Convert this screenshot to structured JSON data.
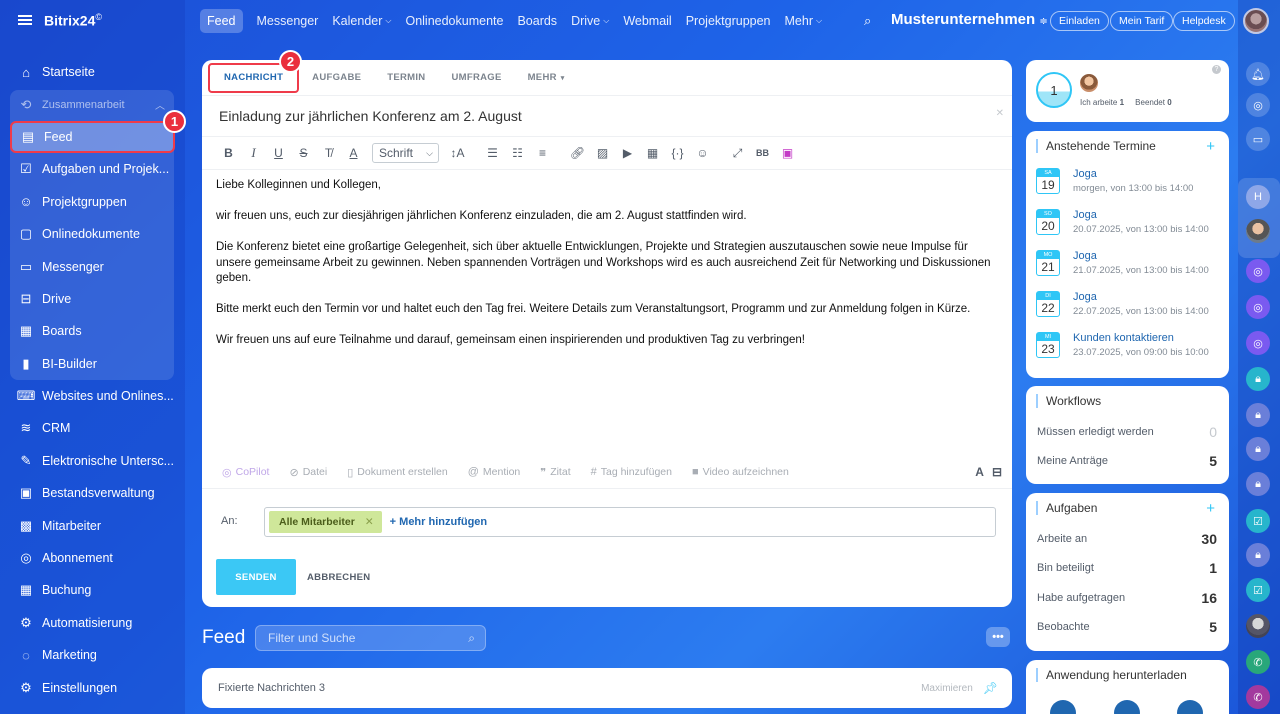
{
  "app": {
    "logo": "Bitrix24",
    "logo_mark": "©"
  },
  "sidebar": {
    "items": [
      {
        "label": "Startseite",
        "icon": "⌂"
      },
      {
        "label": "Zusammenarbeit",
        "icon": "⟲"
      },
      {
        "label": "Feed",
        "icon": "▤"
      },
      {
        "label": "Aufgaben und Projek...",
        "icon": "☑"
      },
      {
        "label": "Projektgruppen",
        "icon": "☺"
      },
      {
        "label": "Onlinedokumente",
        "icon": "▢"
      },
      {
        "label": "Messenger",
        "icon": "▭"
      },
      {
        "label": "Drive",
        "icon": "⊟"
      },
      {
        "label": "Boards",
        "icon": "▦"
      },
      {
        "label": "BI-Builder",
        "icon": "▮"
      },
      {
        "label": "Websites und Onlines...",
        "icon": "⌨"
      },
      {
        "label": "CRM",
        "icon": "≋"
      },
      {
        "label": "Elektronische Untersc...",
        "icon": "✎"
      },
      {
        "label": "Bestandsverwaltung",
        "icon": "▣"
      },
      {
        "label": "Mitarbeiter",
        "icon": "▩"
      },
      {
        "label": "Abonnement",
        "icon": "◎"
      },
      {
        "label": "Buchung",
        "icon": "▦"
      },
      {
        "label": "Automatisierung",
        "icon": "⚙"
      },
      {
        "label": "Marketing",
        "icon": "◌"
      },
      {
        "label": "Einstellungen",
        "icon": "⚙"
      }
    ],
    "badge": "1"
  },
  "topbar": {
    "items": [
      "Feed",
      "Messenger",
      "Kalender",
      "Onlinedokumente",
      "Boards",
      "Drive",
      "Webmail",
      "Projektgruppen",
      "Mehr"
    ],
    "company": "Musterunternehmen",
    "invite": "Einladen",
    "tariff": "Mein Tarif",
    "helpdesk": "Helpdesk"
  },
  "composer": {
    "tabs": [
      "NACHRICHT",
      "AUFGABE",
      "TERMIN",
      "UMFRAGE",
      "MEHR"
    ],
    "badge": "2",
    "title": "Einladung zur jährlichen Konferenz am 2. August",
    "font": "Schrift",
    "body": [
      "Liebe Kolleginnen und Kollegen,",
      "wir freuen uns, euch zur diesjährigen jährlichen Konferenz einzuladen, die am 2. August stattfinden wird.",
      "Die Konferenz bietet eine großartige Gelegenheit, sich über aktuelle Entwicklungen, Projekte und Strategien auszutauschen sowie neue Impulse für unsere gemeinsame Arbeit zu gewinnen. Neben spannenden Vorträgen und Workshops wird es auch ausreichend Zeit für Networking und Diskussionen geben.",
      "Bitte merkt euch den Termin vor und haltet euch den Tag frei. Weitere Details zum Veranstaltungsort, Programm und zur Anmeldung folgen in Kürze.",
      "Wir freuen uns auf eure Teilnahme und darauf, gemeinsam einen inspirierenden und produktiven Tag zu verbringen!"
    ],
    "bottom_tools": [
      "CoPilot",
      "Datei",
      "Dokument erstellen",
      "Mention",
      "Zitat",
      "Tag hinzufügen",
      "Video aufzeichnen"
    ],
    "to_label": "An:",
    "recipient": "Alle Mitarbeiter",
    "add_more": "+ Mehr hinzufügen",
    "send": "SENDEN",
    "cancel": "ABBRECHEN"
  },
  "feed": {
    "title": "Feed",
    "filter_placeholder": "Filter und Suche",
    "pinned": "Fixierte Nachrichten",
    "pinned_count": "3",
    "maximize": "Maximieren"
  },
  "worktime": {
    "count": "1",
    "working_label": "Ich arbeite",
    "working": "1",
    "done_label": "Beendet",
    "done": "0"
  },
  "events": {
    "title": "Anstehende Termine",
    "items": [
      {
        "day": "SA",
        "num": "19",
        "name": "Joga",
        "time": "morgen, von 13:00 bis 14:00"
      },
      {
        "day": "SO",
        "num": "20",
        "name": "Joga",
        "time": "20.07.2025, von 13:00 bis 14:00"
      },
      {
        "day": "MO",
        "num": "21",
        "name": "Joga",
        "time": "21.07.2025, von 13:00 bis 14:00"
      },
      {
        "day": "DI",
        "num": "22",
        "name": "Joga",
        "time": "22.07.2025, von 13:00 bis 14:00"
      },
      {
        "day": "MI",
        "num": "23",
        "name": "Kunden kontaktieren",
        "time": "23.07.2025, von 09:00 bis 10:00"
      }
    ]
  },
  "workflows": {
    "title": "Workflows",
    "rows": [
      {
        "label": "Müssen erledigt werden",
        "value": "0"
      },
      {
        "label": "Meine Anträge",
        "value": "5"
      }
    ]
  },
  "tasks": {
    "title": "Aufgaben",
    "rows": [
      {
        "label": "Arbeite an",
        "value": "30"
      },
      {
        "label": "Bin beteiligt",
        "value": "1"
      },
      {
        "label": "Habe aufgetragen",
        "value": "16"
      },
      {
        "label": "Beobachte",
        "value": "5"
      }
    ]
  },
  "download": {
    "title": "Anwendung herunterladen"
  },
  "colors": {
    "accent": "#2fc6f6",
    "highlight": "#ef3b4a",
    "link": "#2067b0"
  }
}
